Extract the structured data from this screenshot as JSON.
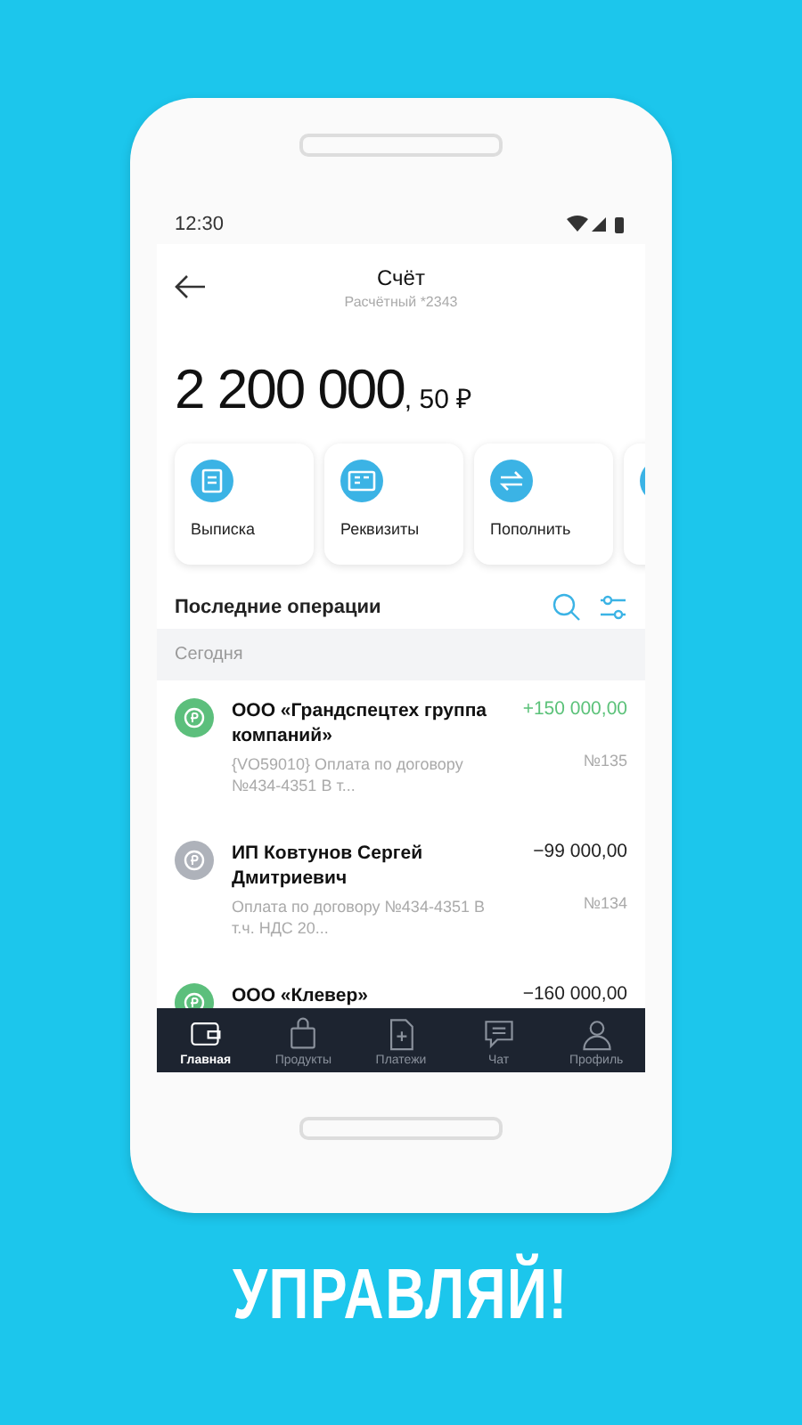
{
  "status_bar": {
    "time": "12:30"
  },
  "header": {
    "title": "Счёт",
    "subtitle": "Расчётный *2343"
  },
  "balance": {
    "whole": "2 200 000",
    "fraction": ", 50 ₽"
  },
  "actions": [
    {
      "label": "Выписка",
      "kind": "statement"
    },
    {
      "label": "Реквизиты",
      "kind": "details"
    },
    {
      "label": "Пополнить",
      "kind": "transfer"
    },
    {
      "kind": "more"
    }
  ],
  "operations": {
    "title": "Последние операции",
    "group": "Сегодня",
    "rows": [
      {
        "name": "ООО «Грандспецтех группа компаний»",
        "amount": "+150 000,00",
        "incoming": true,
        "description": "{VO59010} Оплата по договору №434-4351 В т...",
        "number": "№135"
      },
      {
        "name": "ИП Ковтунов Сергей Дмитриевич",
        "amount": "−99 000,00",
        "incoming": false,
        "description": "Оплата по договору №434-4351 В т.ч. НДС 20...",
        "number": "№134"
      },
      {
        "name": "ООО «Клевер»",
        "amount": "−160 000,00",
        "incoming": true
      }
    ]
  },
  "tabs": [
    {
      "label": "Главная",
      "kind": "wallet",
      "selected": true
    },
    {
      "label": "Продукты",
      "kind": "bag",
      "selected": false
    },
    {
      "label": "Платежи",
      "kind": "doc",
      "selected": false
    },
    {
      "label": "Чат",
      "kind": "chat",
      "selected": false
    },
    {
      "label": "Профиль",
      "kind": "person",
      "selected": false
    }
  ],
  "slogan": "УПРАВЛЯЙ!"
}
